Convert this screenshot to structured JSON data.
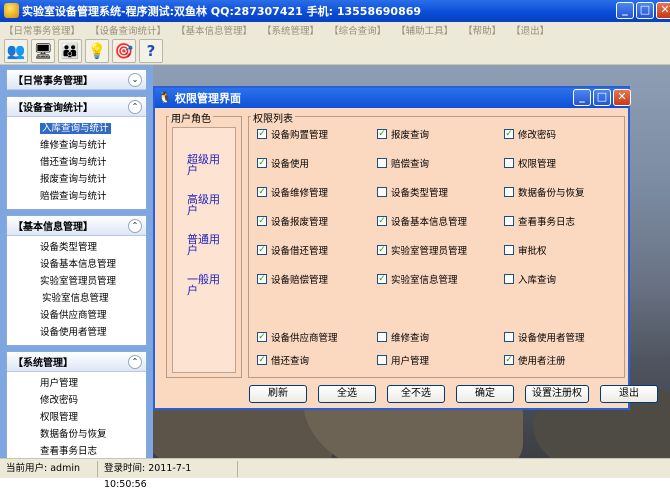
{
  "window": {
    "title": "实验室设备管理系统-程序测试:双鱼林 QQ:287307421 手机: 13558690869"
  },
  "menu": [
    "【日常事务管理】",
    "【设备查询统计】",
    "【基本信息管理】",
    "【系统管理】",
    "【综合查询】",
    "【辅助工具】",
    "【帮助】",
    "【退出】"
  ],
  "toolbar": {
    "icons": [
      "users-icon",
      "monitor-icon",
      "people-icon",
      "lightbulb-icon",
      "target-icon",
      "help-icon"
    ]
  },
  "sidebar": {
    "groups": [
      {
        "title": "【日常事务管理】",
        "items": []
      },
      {
        "title": "【设备查询统计】",
        "items": [
          "入库查询与统计",
          "维修查询与统计",
          "借还查询与统计",
          "报废查询与统计",
          "赔偿查询与统计"
        ]
      },
      {
        "title": "【基本信息管理】",
        "items": [
          "设备类型管理",
          "设备基本信息管理",
          "实验室管理员管理",
          "实验室信息管理",
          "设备供应商管理",
          "设备使用者管理"
        ]
      },
      {
        "title": "【系统管理】",
        "items": [
          "用户管理",
          "修改密码",
          "权限管理",
          "数据备份与恢复",
          "查看事务日志"
        ]
      }
    ]
  },
  "dialog": {
    "title": "权限管理界面",
    "role_label": "用户角色",
    "roles": [
      "超级用户",
      "高级用户",
      "普通用户",
      "一般用户"
    ],
    "perm_label": "权限列表",
    "permissions": [
      {
        "label": "设备购置管理",
        "checked": true
      },
      {
        "label": "报废查询",
        "checked": true
      },
      {
        "label": "修改密码",
        "checked": true
      },
      {
        "label": "设备使用",
        "checked": true
      },
      {
        "label": "赔偿查询",
        "checked": false
      },
      {
        "label": "权限管理",
        "checked": false
      },
      {
        "label": "设备维修管理",
        "checked": true
      },
      {
        "label": "设备类型管理",
        "checked": false
      },
      {
        "label": "数据备份与恢复",
        "checked": false
      },
      {
        "label": "设备报废管理",
        "checked": true
      },
      {
        "label": "设备基本信息管理",
        "checked": true
      },
      {
        "label": "查看事务日志",
        "checked": false
      },
      {
        "label": "设备借还管理",
        "checked": true
      },
      {
        "label": "实验室管理员管理",
        "checked": true
      },
      {
        "label": "审批权",
        "checked": false
      },
      {
        "label": "设备赔偿管理",
        "checked": true
      },
      {
        "label": "实验室信息管理",
        "checked": true
      },
      {
        "label": "入库查询",
        "checked": false
      },
      {
        "label": "设备供应商管理",
        "checked": true
      },
      {
        "label": "维修查询",
        "checked": false
      },
      {
        "label": "设备使用者管理",
        "checked": false
      },
      {
        "label": "借还查询",
        "checked": true
      },
      {
        "label": "用户管理",
        "checked": false
      },
      {
        "label": "使用者注册",
        "checked": true
      }
    ],
    "buttons": [
      "刷新",
      "全选",
      "全不选",
      "确定",
      "设置注册权",
      "退出"
    ]
  },
  "status": {
    "user": "当前用户: admin",
    "login_time": "登录时间: 2011-7-1 10:50:56"
  }
}
